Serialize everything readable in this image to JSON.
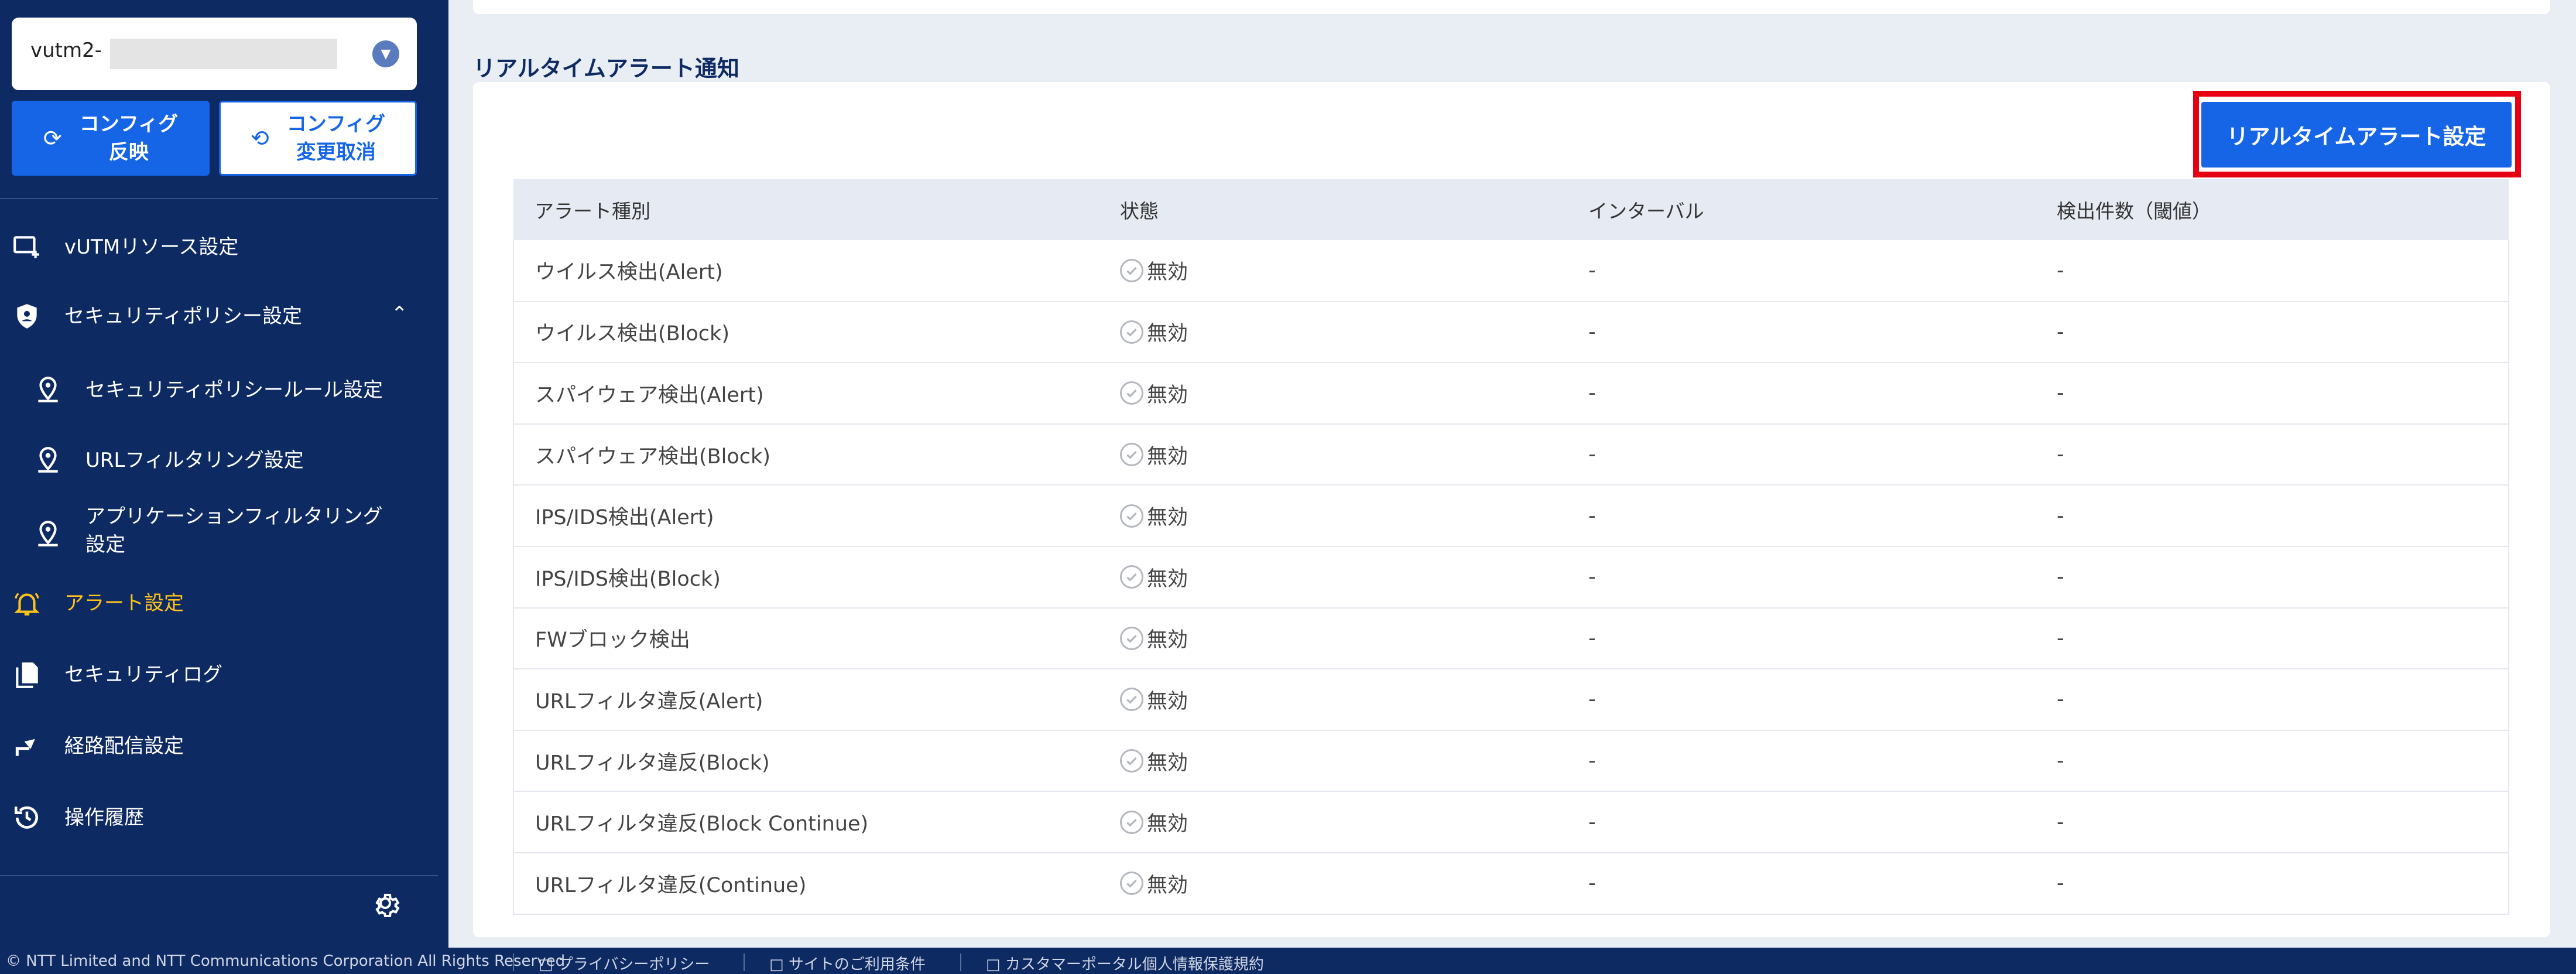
{
  "tenant_select": {
    "value": "vutm2-",
    "masked": true
  },
  "config_buttons": {
    "apply": {
      "line1": "コンフィグ",
      "line2": "反映"
    },
    "cancel": {
      "line1": "コンフィグ",
      "line2": "変更取消"
    }
  },
  "menu": {
    "vutm_resource": "vUTMリソース設定",
    "security_policy": "セキュリティポリシー設定",
    "security_policy_rule": "セキュリティポリシールール設定",
    "url_filtering": "URLフィルタリング設定",
    "app_filtering_line1": "アプリケーションフィルタリング",
    "app_filtering_line2": "設定",
    "alert": "アラート設定",
    "security_log": "セキュリティログ",
    "route": "経路配信設定",
    "history": "操作履歴"
  },
  "section_title": "リアルタイムアラート通知",
  "realtime_button": "リアルタイムアラート設定",
  "table": {
    "headers": [
      "アラート種別",
      "状態",
      "インターバル",
      "検出件数（閾値）"
    ],
    "rows": [
      {
        "type": "ウイルス検出(Alert)",
        "status": "無効",
        "interval": "-",
        "count": "-"
      },
      {
        "type": "ウイルス検出(Block)",
        "status": "無効",
        "interval": "-",
        "count": "-"
      },
      {
        "type": "スパイウェア検出(Alert)",
        "status": "無効",
        "interval": "-",
        "count": "-"
      },
      {
        "type": "スパイウェア検出(Block)",
        "status": "無効",
        "interval": "-",
        "count": "-"
      },
      {
        "type": "IPS/IDS検出(Alert)",
        "status": "無効",
        "interval": "-",
        "count": "-"
      },
      {
        "type": "IPS/IDS検出(Block)",
        "status": "無効",
        "interval": "-",
        "count": "-"
      },
      {
        "type": "FWブロック検出",
        "status": "無効",
        "interval": "-",
        "count": "-"
      },
      {
        "type": "URLフィルタ違反(Alert)",
        "status": "無効",
        "interval": "-",
        "count": "-"
      },
      {
        "type": "URLフィルタ違反(Block)",
        "status": "無効",
        "interval": "-",
        "count": "-"
      },
      {
        "type": "URLフィルタ違反(Block Continue)",
        "status": "無効",
        "interval": "-",
        "count": "-"
      },
      {
        "type": "URLフィルタ違反(Continue)",
        "status": "無効",
        "interval": "-",
        "count": "-"
      }
    ]
  },
  "footer": {
    "copyright": "© NTT Limited and NTT Communications Corporation All Rights Reserved.",
    "privacy": "プライバシーポリシー",
    "terms": "サイトのご利用条件",
    "customer": "カスタマーポータル個人情報保護規約"
  },
  "colors": {
    "sidebar_bg": "#0e2a63",
    "primary_blue": "#1565e6",
    "active_menu": "#ffc21a",
    "highlight_red": "#e60012"
  },
  "icons": {
    "tenant": "chevron-down-icon",
    "apply": "sync-icon",
    "cancel": "sync-off-icon",
    "vutm_resource": "monitor-add-icon",
    "security_policy": "shield-icon",
    "sub_items": "location-pin-icon",
    "alert": "bell-icon",
    "security_log": "document-icon",
    "route": "route-arrow-icon",
    "history": "history-icon",
    "settings": "gear-icon",
    "status": "check-circle-icon"
  }
}
